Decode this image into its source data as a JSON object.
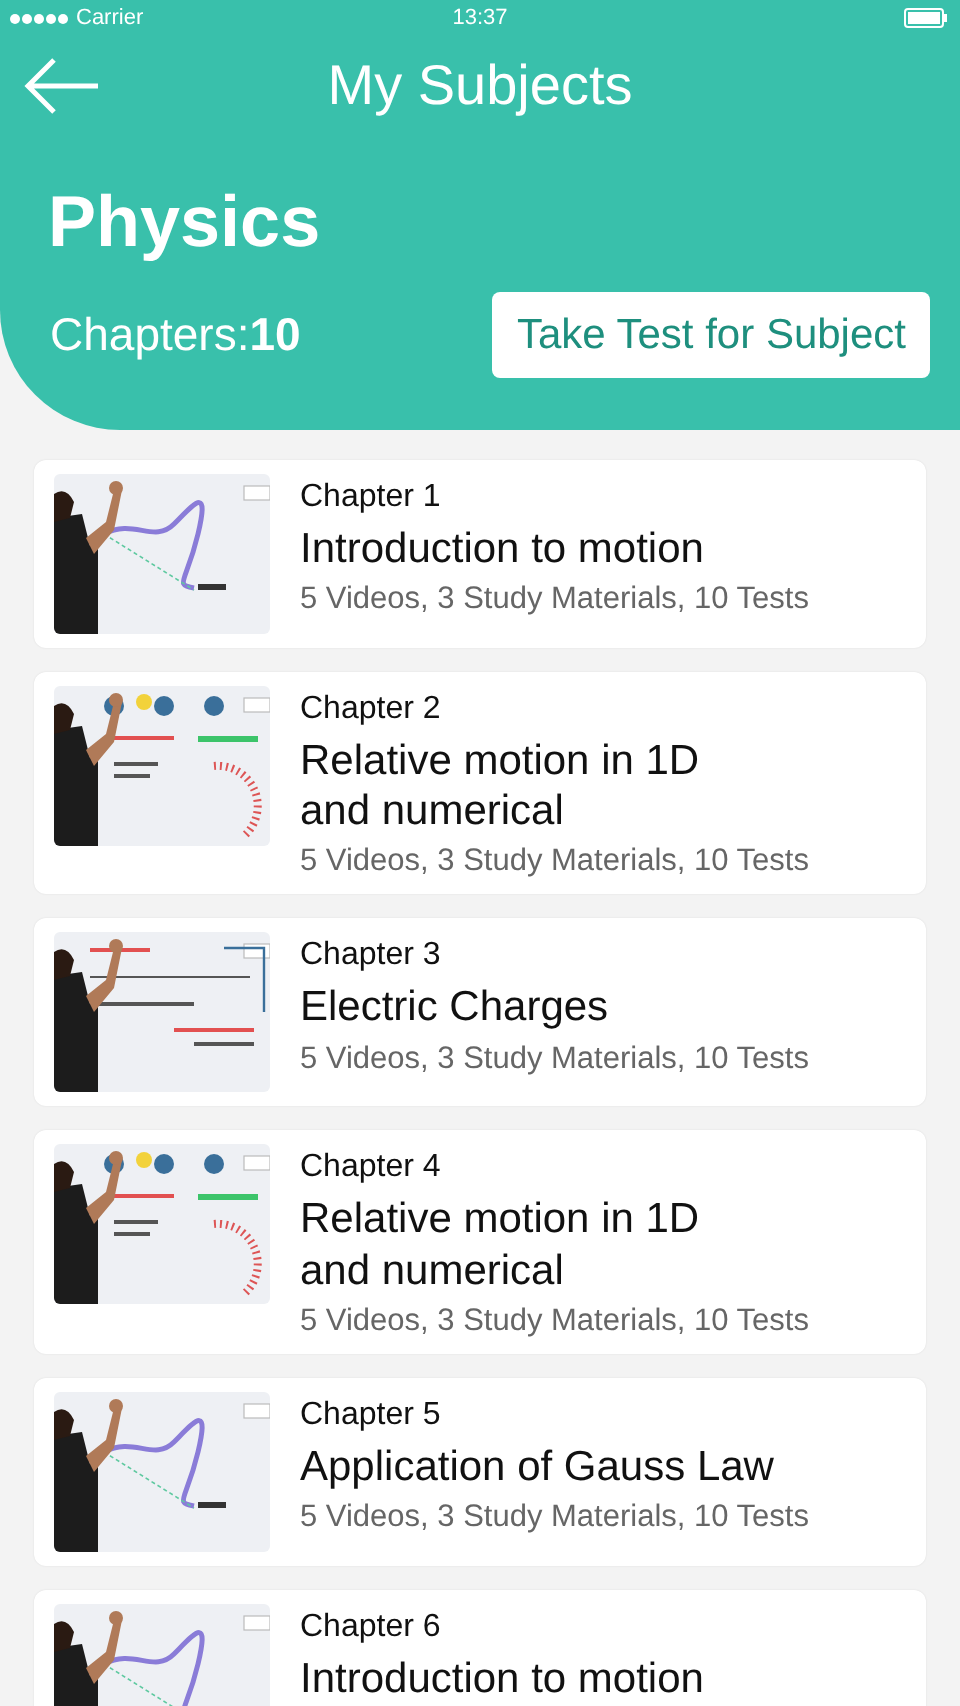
{
  "status_bar": {
    "carrier": "Carrier",
    "time": "13:37"
  },
  "header": {
    "title": "My Subjects",
    "subject": "Physics",
    "chapters_label": "Chapters:",
    "chapters_count": "10",
    "test_button": "Take Test for Subject"
  },
  "chapters": [
    {
      "label": "Chapter 1",
      "title": [
        "Introduction to motion"
      ],
      "meta": "5 Videos, 3 Study Materials, 10 Tests",
      "thumbnail": {
        "kind": "picture"
      }
    },
    {
      "label": "Chapter 2",
      "title": [
        "Relative motion in 1D",
        "and numerical"
      ],
      "meta": "5 Videos, 3 Study Materials, 10 Tests",
      "thumbnail": {
        "kind": "picture"
      }
    },
    {
      "label": "Chapter 3",
      "title": [
        "Electric Charges"
      ],
      "meta": "5 Videos, 3 Study Materials, 10 Tests",
      "thumbnail": {
        "kind": "picture"
      }
    },
    {
      "label": "Chapter 4",
      "title": [
        "Relative motion in 1D",
        "and numerical"
      ],
      "meta": "5 Videos, 3 Study Materials, 10 Tests",
      "thumbnail": {
        "kind": "picture"
      }
    },
    {
      "label": "Chapter 5",
      "title": [
        "Application of Gauss Law"
      ],
      "meta": "5 Videos, 3 Study Materials, 10 Tests",
      "thumbnail": {
        "kind": "picture"
      }
    },
    {
      "label": "Chapter 6",
      "title": [
        "Introduction to motion"
      ],
      "thumbnail": {
        "kind": "picture"
      }
    }
  ]
}
